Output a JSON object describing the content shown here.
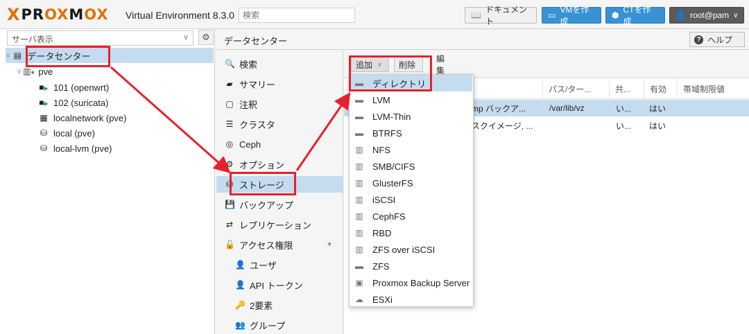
{
  "app": {
    "logo_x": "X",
    "logo_pr": "PR",
    "logo_ox": "OX",
    "logo_m": "M",
    "logo_ox2": "OX",
    "product": "Virtual Environment 8.3.0",
    "search_placeholder": "検索",
    "doc_label": "ドキュメント",
    "create_vm_label": "VMを作成",
    "create_ct_label": "CTを作成",
    "user_label": "root@pam",
    "accent": "#e57000",
    "button_blue": "#3892d4"
  },
  "left": {
    "view_label": "サーバ表示",
    "tree": {
      "datacenter": "データセンター",
      "node": "pve",
      "items": [
        {
          "label": "101 (openwrt)"
        },
        {
          "label": "102 (suricata)"
        },
        {
          "label": "localnetwork (pve)"
        },
        {
          "label": "local (pve)"
        },
        {
          "label": "local-lvm (pve)"
        }
      ]
    }
  },
  "main": {
    "title": "データセンター",
    "help_label": "ヘルプ"
  },
  "subnav": [
    {
      "label": "検索",
      "icon": "search-icon"
    },
    {
      "label": "サマリー",
      "icon": "book-icon"
    },
    {
      "label": "注釈",
      "icon": "note-icon"
    },
    {
      "label": "クラスタ",
      "icon": "server-icon"
    },
    {
      "label": "Ceph",
      "icon": "ceph-icon"
    },
    {
      "label": "オプション",
      "icon": "gear-icon"
    },
    {
      "label": "ストレージ",
      "icon": "database-icon"
    },
    {
      "label": "バックアップ",
      "icon": "floppy-icon"
    },
    {
      "label": "レプリケーション",
      "icon": "retweet-icon"
    },
    {
      "label": "アクセス権限",
      "icon": "unlock-icon"
    },
    {
      "label": "ユーザ",
      "icon": "user-icon"
    },
    {
      "label": "API トークン",
      "icon": "user-o-icon"
    },
    {
      "label": "2要素",
      "icon": "key-icon"
    },
    {
      "label": "グループ",
      "icon": "users-icon"
    }
  ],
  "toolbar": {
    "add_label": "追加",
    "delete_label": "削除",
    "edit_label": "編集"
  },
  "grid": {
    "columns": [
      "パス/ター...",
      "共...",
      "有効",
      "帯域制限値"
    ],
    "rows": [
      {
        "content": "mp バックア...",
        "path": "/var/lib/vz",
        "shared": "い...",
        "enabled": "はい"
      },
      {
        "content": "スクイメージ, ...",
        "path": "",
        "shared": "い...",
        "enabled": "はい"
      }
    ]
  },
  "add_menu": [
    {
      "label": "ディレクトリ",
      "icon": "folder-icon"
    },
    {
      "label": "LVM",
      "icon": "folder-icon"
    },
    {
      "label": "LVM-Thin",
      "icon": "folder-icon"
    },
    {
      "label": "BTRFS",
      "icon": "folder-icon"
    },
    {
      "label": "NFS",
      "icon": "building-icon"
    },
    {
      "label": "SMB/CIFS",
      "icon": "building-icon"
    },
    {
      "label": "GlusterFS",
      "icon": "building-icon"
    },
    {
      "label": "iSCSI",
      "icon": "building-icon"
    },
    {
      "label": "CephFS",
      "icon": "building-icon"
    },
    {
      "label": "RBD",
      "icon": "building-icon"
    },
    {
      "label": "ZFS over iSCSI",
      "icon": "building-icon"
    },
    {
      "label": "ZFS",
      "icon": "folder-icon"
    },
    {
      "label": "Proxmox Backup Server",
      "icon": "floppy-icon"
    },
    {
      "label": "ESXi",
      "icon": "cloud-download-icon"
    }
  ]
}
